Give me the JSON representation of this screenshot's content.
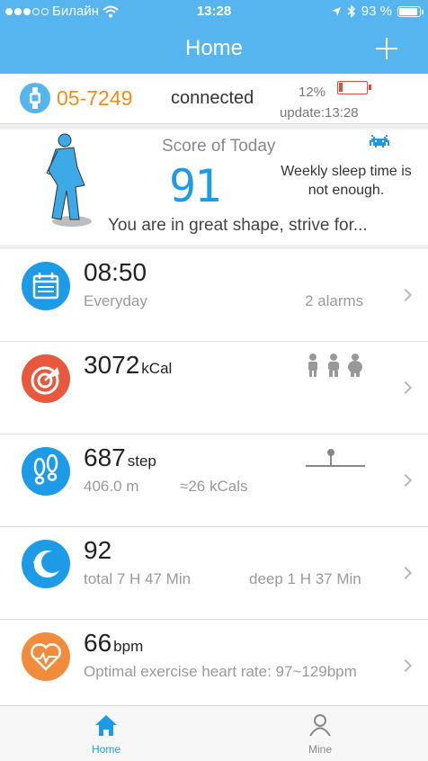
{
  "status_bar": {
    "carrier": "Билайн",
    "time": "13:28",
    "battery_percent": "93 %",
    "battery_level": 0.93
  },
  "nav": {
    "title": "Home",
    "add_icon": "plus-icon"
  },
  "device": {
    "name": "05-7249",
    "status": "connected",
    "battery": "12%",
    "battery_level": 0.12,
    "update": "update:13:28",
    "colors": {
      "name": "#F08C1E",
      "battery": "#E8483C"
    }
  },
  "score": {
    "title": "Score of Today",
    "value": "91",
    "weekly_message": "Weekly sleep time is not enough.",
    "message": "You are in great shape, strive for...",
    "invader_icon": "space-invader-icon"
  },
  "alarm": {
    "time": "08:50",
    "repeat": "Everyday",
    "count": "2 alarms",
    "icon": "calendar-icon",
    "color": "#1E9BE6"
  },
  "calories": {
    "value": "3072",
    "unit": "kCal",
    "icon": "target-arrow-icon",
    "people_icon": "body-types-icon",
    "color": "#E8583C"
  },
  "steps": {
    "value": "687",
    "unit": "step",
    "distance": "406.0 m",
    "kcals": "≈26 kCals",
    "icon": "footprints-icon",
    "color": "#1E9BE6"
  },
  "sleep": {
    "value": "92",
    "total": "total 7 H 47 Min",
    "deep": "deep 1 H 37 Min",
    "icon": "moon-stars-icon",
    "color": "#1E9BE6"
  },
  "heart": {
    "value": "66",
    "unit": "bpm",
    "optimal": "Optimal exercise heart rate: 97~129bpm",
    "icon": "heart-pulse-icon",
    "color": "#F08C3C"
  },
  "tabs": [
    {
      "label": "Home",
      "icon": "home-icon",
      "active": true
    },
    {
      "label": "Mine",
      "icon": "person-icon",
      "active": false
    }
  ],
  "accent": "#56B4EE"
}
